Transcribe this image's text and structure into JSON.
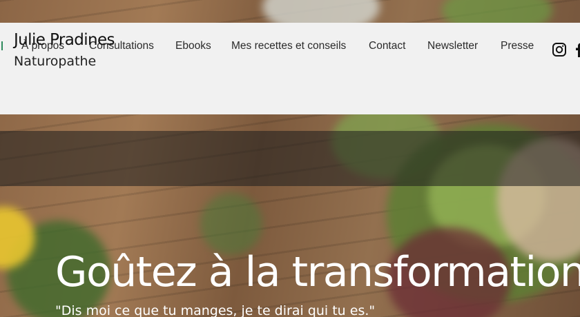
{
  "brand": {
    "name": "Julie Pradines",
    "subtitle": "Naturopathe"
  },
  "nav": {
    "items": [
      {
        "label": "À propos"
      },
      {
        "label": "Consultations"
      },
      {
        "label": "Ebooks"
      },
      {
        "label": "Mes recettes et conseils"
      },
      {
        "label": "Contact"
      },
      {
        "label": "Newsletter"
      },
      {
        "label": "Presse"
      }
    ],
    "accent_color": "#2e8a5c"
  },
  "social": {
    "icons": [
      "instagram-icon",
      "facebook-icon"
    ]
  },
  "hero": {
    "title": "Goûtez à la transformation",
    "quote": "\"Dis moi ce que tu manges, je te dirai qui tu es.\""
  },
  "colors": {
    "header_bg": "#f1f1f1",
    "text_dark": "#111111",
    "hero_text": "#ffffff"
  }
}
